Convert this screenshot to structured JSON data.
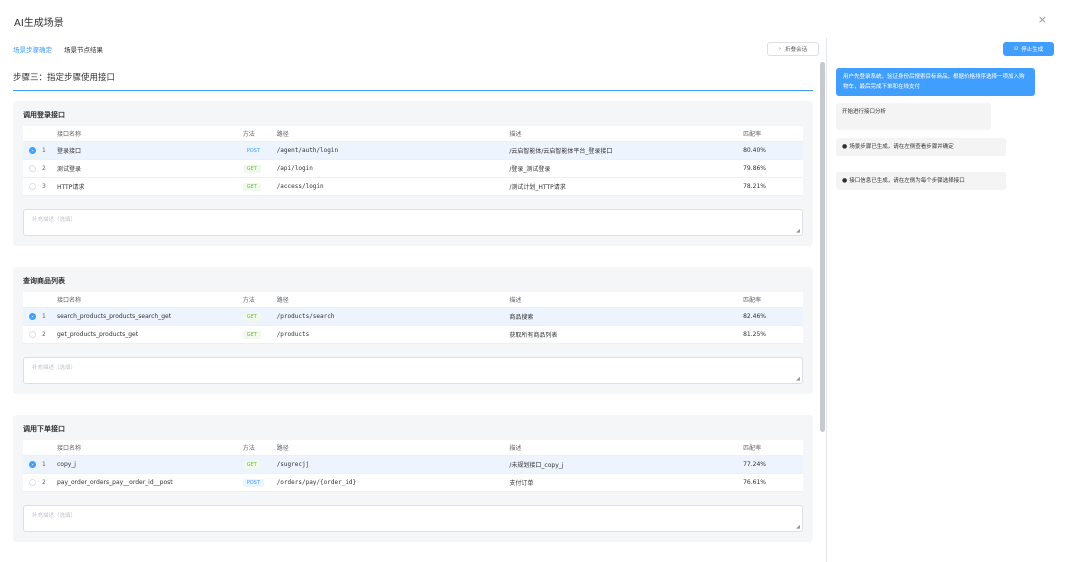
{
  "dialog": {
    "title": "AI生成场景",
    "close_icon": "×"
  },
  "tabs": [
    {
      "label": "场景步骤确定",
      "active": true
    },
    {
      "label": "场景节点结果",
      "active": false
    }
  ],
  "toolbar": {
    "collapse_label": "折叠会话",
    "stop_label": "停止生成"
  },
  "step_title": "步骤三：指定步骤使用接口",
  "table_headers": {
    "name": "接口名称",
    "method": "方法",
    "path": "路径",
    "desc": "描述",
    "match": "匹配率"
  },
  "textarea_placeholder": "补充描述（选填）",
  "cards": [
    {
      "title": "调用登录接口",
      "rows": [
        {
          "index": "1",
          "name": "登录接口",
          "method": "POST",
          "path": "/agent/auth/login",
          "desc": "/云启智能体/云启智能体平台_登录接口",
          "match": "80.40%",
          "selected": true
        },
        {
          "index": "2",
          "name": "测试登录",
          "method": "GET",
          "path": "/api/login",
          "desc": "/登录_测试登录",
          "match": "79.86%",
          "selected": false
        },
        {
          "index": "3",
          "name": "HTTP请求",
          "method": "GET",
          "path": "/access/login",
          "desc": "/测试计划_HTTP请求",
          "match": "78.21%",
          "selected": false
        }
      ]
    },
    {
      "title": "查询商品列表",
      "rows": [
        {
          "index": "1",
          "name": "search_products_products_search_get",
          "method": "GET",
          "path": "/products/search",
          "desc": "商品搜索",
          "match": "82.46%",
          "selected": true
        },
        {
          "index": "2",
          "name": "get_products_products_get",
          "method": "GET",
          "path": "/products",
          "desc": "获取所有商品列表",
          "match": "81.25%",
          "selected": false
        }
      ]
    },
    {
      "title": "调用下单接口",
      "rows": [
        {
          "index": "1",
          "name": "copy_j",
          "method": "GET",
          "path": "/sugrecjj",
          "desc": "/未规划接口_copy_j",
          "match": "77.24%",
          "selected": true
        },
        {
          "index": "2",
          "name": "pay_order_orders_pay__order_id__post",
          "method": "POST",
          "path": "/orders/pay/{order_id}",
          "desc": "支付订单",
          "match": "76.61%",
          "selected": false
        }
      ]
    }
  ],
  "chat": {
    "user_message": "用户先登录系统，验证身份后搜索目标商品，根据价格排序选择一项加入购物车，最后完成下单和在线支付",
    "messages": [
      "开始进行接口分析",
      "场景步骤已生成，请在左侧查看步骤并确定",
      "接口信息已生成，请在左侧为每个步骤选择接口"
    ]
  },
  "colors": {
    "accent": "#409eff",
    "get": "#67c23a",
    "card_bg": "#f5f6f8"
  },
  "icons": {
    "close": "close-icon",
    "collapse": "chevron-right-icon",
    "stop": "stop-icon",
    "info": "info-circle-icon"
  }
}
